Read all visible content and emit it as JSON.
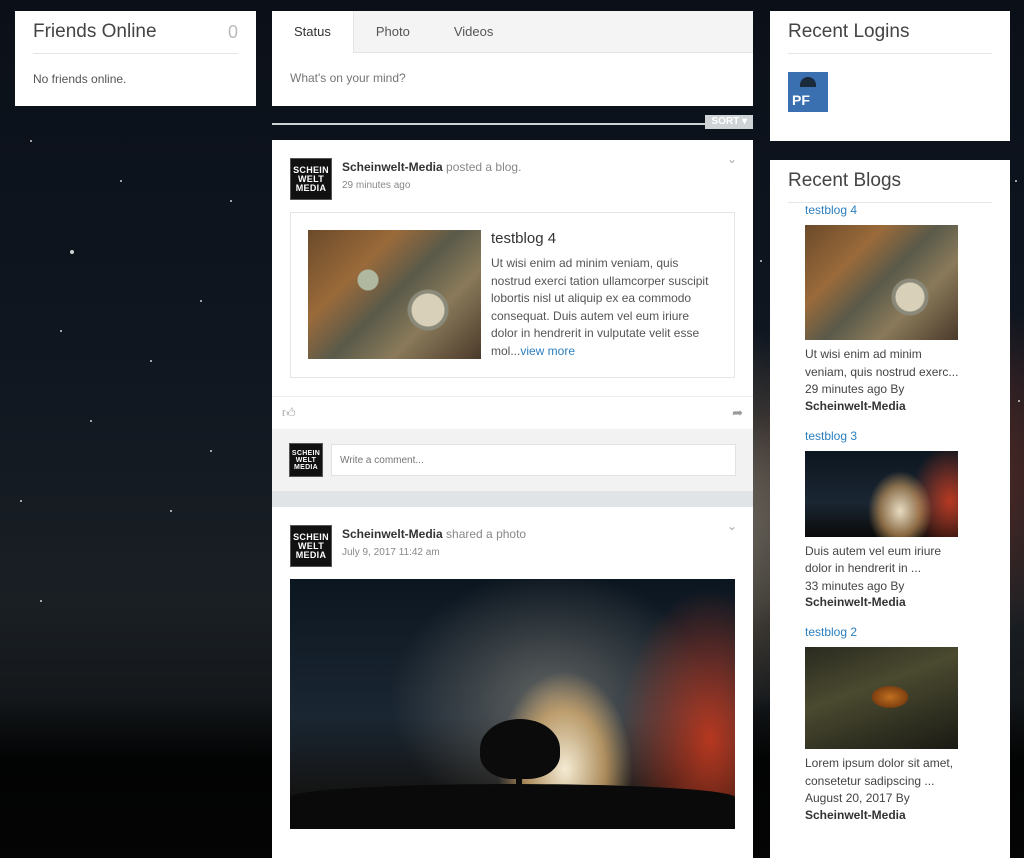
{
  "friends": {
    "title": "Friends Online",
    "count": "0",
    "empty_text": "No friends online."
  },
  "composer": {
    "tabs": [
      {
        "label": "Status"
      },
      {
        "label": "Photo"
      },
      {
        "label": "Videos"
      }
    ],
    "placeholder": "What's on your mind?"
  },
  "sort": {
    "label": "SORT",
    "icon": "caret-down-icon"
  },
  "feed": {
    "post1": {
      "avatar_lines": [
        "SCHEIN",
        "WELT",
        "MEDIA"
      ],
      "author": "Scheinwelt-Media",
      "action": "posted a blog.",
      "time": "29 minutes ago",
      "blog_title": "testblog 4",
      "blog_excerpt": "Ut wisi enim ad minim veniam, quis nostrud exerci tation ullamcorper suscipit lobortis nisl ut aliquip ex ea commodo consequat. Duis autem vel eum iriure dolor in hendrerit in vulputate velit esse mol...",
      "view_more": "view more"
    },
    "comment_placeholder": "Write a comment...",
    "post2": {
      "avatar_lines": [
        "SCHEIN",
        "WELT",
        "MEDIA"
      ],
      "author": "Scheinwelt-Media",
      "action": "shared a photo",
      "time": "July 9, 2017 11:42 am"
    }
  },
  "logins": {
    "title": "Recent Logins",
    "avatar_text": "PF"
  },
  "blogs": {
    "title": "Recent Blogs",
    "items": [
      {
        "title": "testblog 4",
        "excerpt_line1": "Ut wisi enim ad minim",
        "excerpt_line2": "veniam, quis nostrud exerc...",
        "meta": "29 minutes ago By",
        "author": "Scheinwelt-Media"
      },
      {
        "title": "testblog 3",
        "excerpt_line1": "Duis autem vel eum iriure",
        "excerpt_line2": "dolor in hendrerit in ...",
        "meta": "33 minutes ago By",
        "author": "Scheinwelt-Media"
      },
      {
        "title": "testblog 2",
        "excerpt_line1": "Lorem ipsum dolor sit amet,",
        "excerpt_line2": "consetetur sadipscing ...",
        "meta": "August 20, 2017 By",
        "author": "Scheinwelt-Media"
      }
    ]
  },
  "colors": {
    "link": "#2b7fbf",
    "panel": "#ffffff"
  }
}
